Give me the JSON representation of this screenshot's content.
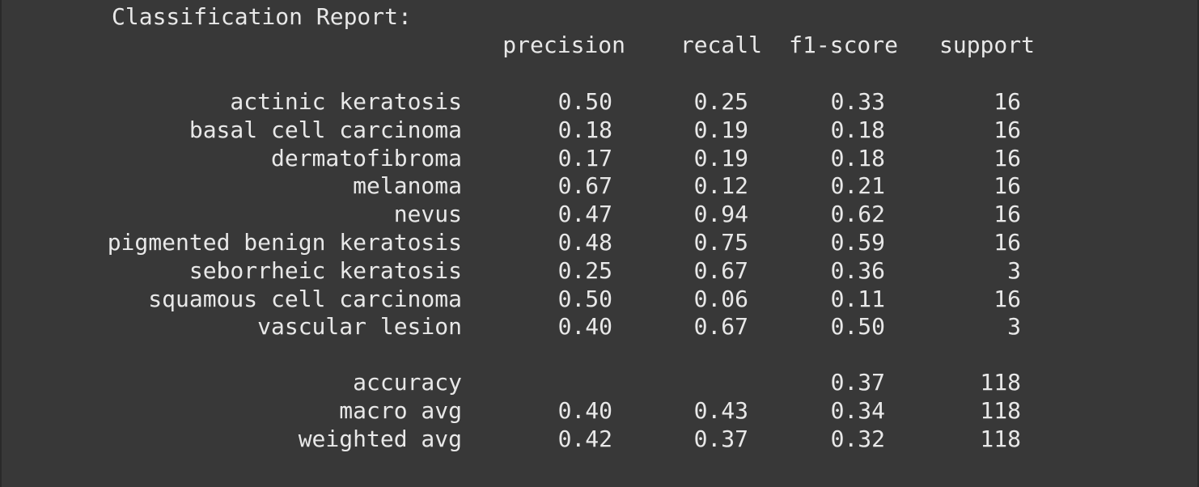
{
  "report": {
    "title": "Classification Report:",
    "headers": {
      "precision": "precision",
      "recall": "recall",
      "f1": "f1-score",
      "support": "support"
    },
    "rows": [
      {
        "label": "actinic keratosis",
        "precision": "0.50",
        "recall": "0.25",
        "f1": "0.33",
        "support": "16"
      },
      {
        "label": "basal cell carcinoma",
        "precision": "0.18",
        "recall": "0.19",
        "f1": "0.18",
        "support": "16"
      },
      {
        "label": "dermatofibroma",
        "precision": "0.17",
        "recall": "0.19",
        "f1": "0.18",
        "support": "16"
      },
      {
        "label": "melanoma",
        "precision": "0.67",
        "recall": "0.12",
        "f1": "0.21",
        "support": "16"
      },
      {
        "label": "nevus",
        "precision": "0.47",
        "recall": "0.94",
        "f1": "0.62",
        "support": "16"
      },
      {
        "label": "pigmented benign keratosis",
        "precision": "0.48",
        "recall": "0.75",
        "f1": "0.59",
        "support": "16"
      },
      {
        "label": "seborrheic keratosis",
        "precision": "0.25",
        "recall": "0.67",
        "f1": "0.36",
        "support": "3"
      },
      {
        "label": "squamous cell carcinoma",
        "precision": "0.50",
        "recall": "0.06",
        "f1": "0.11",
        "support": "16"
      },
      {
        "label": "vascular lesion",
        "precision": "0.40",
        "recall": "0.67",
        "f1": "0.50",
        "support": "3"
      }
    ],
    "summary": [
      {
        "label": "accuracy",
        "precision": "",
        "recall": "",
        "f1": "0.37",
        "support": "118"
      },
      {
        "label": "macro avg",
        "precision": "0.40",
        "recall": "0.43",
        "f1": "0.34",
        "support": "118"
      },
      {
        "label": "weighted avg",
        "precision": "0.42",
        "recall": "0.37",
        "f1": "0.32",
        "support": "118"
      }
    ]
  }
}
